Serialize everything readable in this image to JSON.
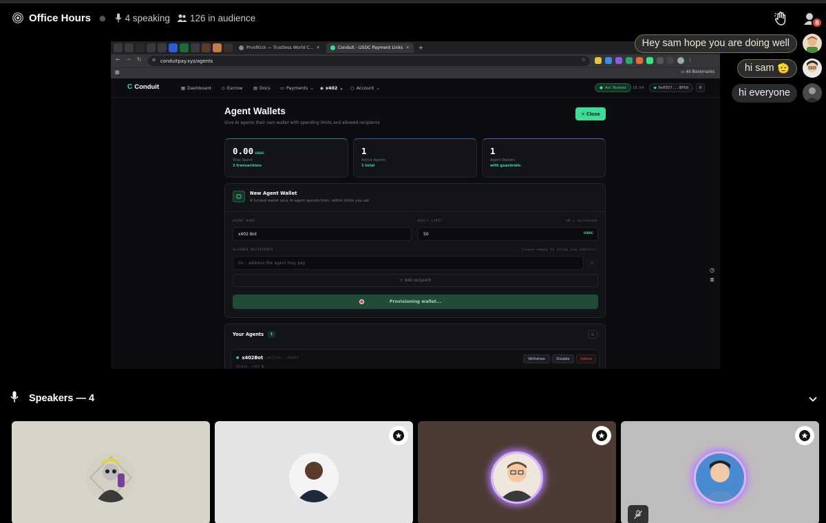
{
  "header": {
    "title": "Office Hours",
    "speaking": "4 speaking",
    "audience": "126 in audience",
    "notification_count": "8"
  },
  "chat": [
    {
      "text": "Hey sam hope you are doing well",
      "style": "gold"
    },
    {
      "text": "hi sam",
      "style": "gold",
      "emoji": "🫡"
    },
    {
      "text": "hi everyone",
      "style": "plain"
    }
  ],
  "browser": {
    "tabs": [
      {
        "label": "ProofKick — Trustless World C..."
      },
      {
        "label": "Conduit - USDC Payment Links",
        "active": true
      }
    ],
    "url": "conduitpay.xyz/agents",
    "all_bookmarks": "All Bookmarks"
  },
  "site": {
    "logo": "Conduit",
    "nav": [
      "Dashboard",
      "Escrow",
      "Docs",
      "Payments",
      "x402",
      "Account"
    ],
    "network": "Arc Testnet",
    "clock": "18:04",
    "wallet": "0x0557...8F69",
    "page_title": "Agent Wallets",
    "page_sub": "Give AI agents their own wallet with spending limits and allowed recipients",
    "close_label": "Close",
    "stats": [
      {
        "value": "0.00",
        "unit": "USDC",
        "label": "Total Spent",
        "note": "2 transactions"
      },
      {
        "value": "1",
        "label": "Active Agents",
        "note": "1 total"
      },
      {
        "value": "1",
        "label": "Agent Wallets",
        "note": "with guardrails"
      }
    ],
    "form": {
      "title": "New Agent Wallet",
      "subtitle": "A funded wallet your AI agent spends from, within limits you set",
      "name_label": "AGENT NAME",
      "name_value": "x402 Bot",
      "limit_label": "DAILY LIMIT",
      "limit_hint": "$0 = unlimited",
      "limit_value": "50",
      "limit_unit": "USDC",
      "recipients_label": "ALLOWED RECIPIENTS",
      "recipients_hint": "(leave empty to allow any address)",
      "recipients_placeholder": "0x... address the agent may pay",
      "add_recipient": "+ Add recipient",
      "provision": "Provisioning wallet..."
    },
    "agents": {
      "title": "Your Agents",
      "count": "1",
      "row": {
        "name": "x402Bot",
        "key": "cpk_live_...4ds8af",
        "address": "0x53e4...c912",
        "actions": [
          "Withdraw",
          "Disable",
          "Delete"
        ]
      }
    }
  },
  "speakers": {
    "title": "Speakers — 4",
    "tiles": [
      {
        "bg": "#d6d5c8",
        "star": false,
        "muted": false
      },
      {
        "bg": "#e4e4e6",
        "star": true,
        "muted": false
      },
      {
        "bg": "#4b3b33",
        "star": true,
        "muted": false
      },
      {
        "bg": "#bfbcbd",
        "star": true,
        "muted": true
      }
    ]
  },
  "colors": {
    "accent": "#3ddc97",
    "danger": "#e5484d",
    "glow": "#b57bff"
  }
}
